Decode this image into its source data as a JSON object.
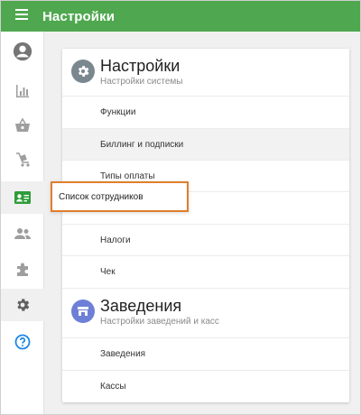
{
  "appbar": {
    "title": "Настройки",
    "menu_icon": "hamburger-menu-icon"
  },
  "rail": {
    "items": [
      {
        "icon": "account-circle-icon",
        "active": false
      },
      {
        "icon": "bar-chart-icon",
        "active": false
      },
      {
        "icon": "basket-icon",
        "active": false
      },
      {
        "icon": "cart-icon",
        "active": false
      },
      {
        "icon": "employee-card-icon",
        "active": true
      },
      {
        "icon": "people-icon",
        "active": false
      },
      {
        "icon": "puzzle-icon",
        "active": false
      },
      {
        "icon": "gear-icon",
        "active": true
      },
      {
        "icon": "help-circle-icon",
        "active": false
      }
    ]
  },
  "popup": {
    "label": "Список сотрудников"
  },
  "settings_section": {
    "title": "Настройки",
    "subtitle": "Настройки системы",
    "items": [
      "Функции",
      "Биллинг и подписки",
      "Типы оплаты",
      "",
      "Налоги",
      "Чек"
    ]
  },
  "places_section": {
    "title": "Заведения",
    "subtitle": "Настройки заведений и касс",
    "items": [
      "Заведения",
      "Кассы"
    ]
  },
  "colors": {
    "appbar": "#4fa84f",
    "rail_icon": "#9e9e9e",
    "active_icon": "#2e9d3a",
    "help_icon": "#1e88e5",
    "popup_border": "#e07e2e",
    "settings_icon_bg": "#7b878f",
    "places_icon_bg": "#6d7fd6"
  }
}
